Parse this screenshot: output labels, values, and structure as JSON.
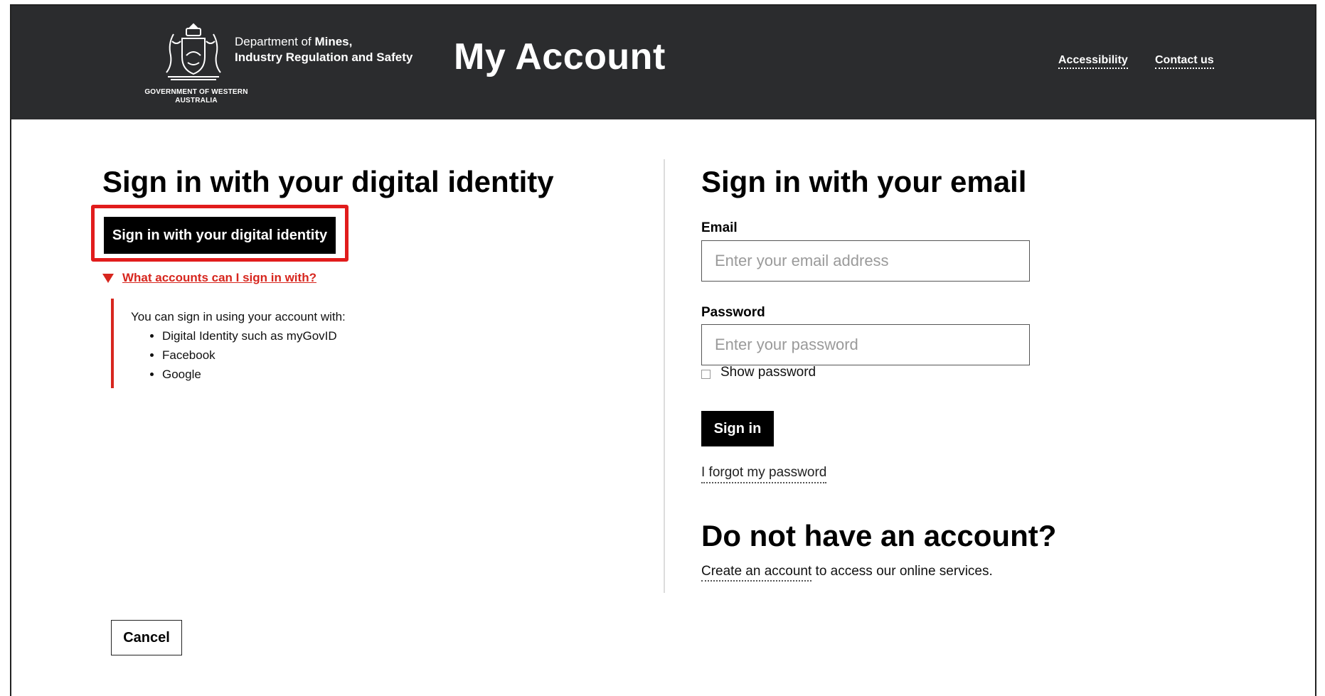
{
  "header": {
    "crest_text": "GOVERNMENT OF WESTERN AUSTRALIA",
    "dept_prefix": "Department of ",
    "dept_bold_1": "Mines,",
    "dept_line_2": "Industry Regulation and Safety",
    "site_title": "My Account",
    "links": {
      "accessibility": "Accessibility",
      "contact": "Contact us"
    },
    "background_color": "#2b2c2e"
  },
  "left_panel": {
    "heading": "Sign in with your digital identity",
    "digital_identity_button": "Sign in with your digital identity",
    "disclosure_label": "What accounts can I sign in with?",
    "details_intro": "You can sign in using your account with:",
    "accounts": [
      "Digital Identity such as myGovID",
      "Facebook",
      "Google"
    ]
  },
  "right_panel": {
    "heading": "Sign in with your email",
    "email_label": "Email",
    "email_placeholder": "Enter your email address",
    "password_label": "Password",
    "password_placeholder": "Enter your password",
    "show_password_label": "Show password",
    "sign_in_button": "Sign in",
    "forgot_link": "I forgot my password",
    "no_account_heading": "Do not have an account?",
    "create_link": "Create an account",
    "create_suffix": " to access our online services."
  },
  "footer": {
    "cancel_button": "Cancel"
  },
  "colors": {
    "accent_red": "#d7261e",
    "highlight_red": "#e11c1c",
    "button_black": "#000000"
  }
}
